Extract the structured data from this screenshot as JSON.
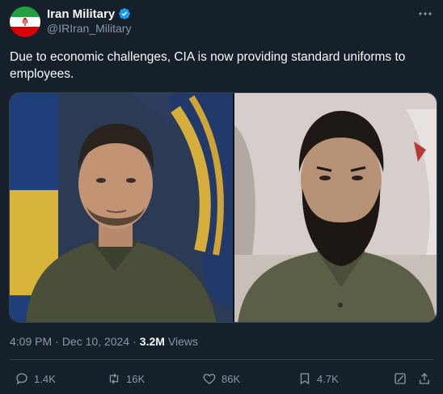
{
  "colors": {
    "background": "#15202b",
    "text_primary": "#f7f9f9",
    "text_secondary": "#8b98a5",
    "verified_badge": "#1d9bf0",
    "divider": "#38444d"
  },
  "author": {
    "display_name": "Iran Military",
    "handle": "@IRIran_Military",
    "verified": true,
    "avatar": "iran-flag-avatar"
  },
  "tweet": {
    "text": "Due to economic challenges, CIA is now providing standard uniforms to employees.",
    "media": {
      "type": "photo-collage",
      "panels": 2
    }
  },
  "meta": {
    "time": "4:09 PM",
    "separator": "·",
    "date": "Dec 10, 2024",
    "dot": "·",
    "views_count": "3.2M",
    "views_label": "Views"
  },
  "actions": {
    "reply": {
      "icon": "reply-icon",
      "count": "1.4K"
    },
    "retweet": {
      "icon": "retweet-icon",
      "count": "16K"
    },
    "like": {
      "icon": "heart-icon",
      "count": "86K"
    },
    "bookmark": {
      "icon": "bookmark-icon",
      "count": "4.7K"
    },
    "grok": {
      "icon": "grok-icon"
    },
    "share": {
      "icon": "share-icon"
    }
  }
}
